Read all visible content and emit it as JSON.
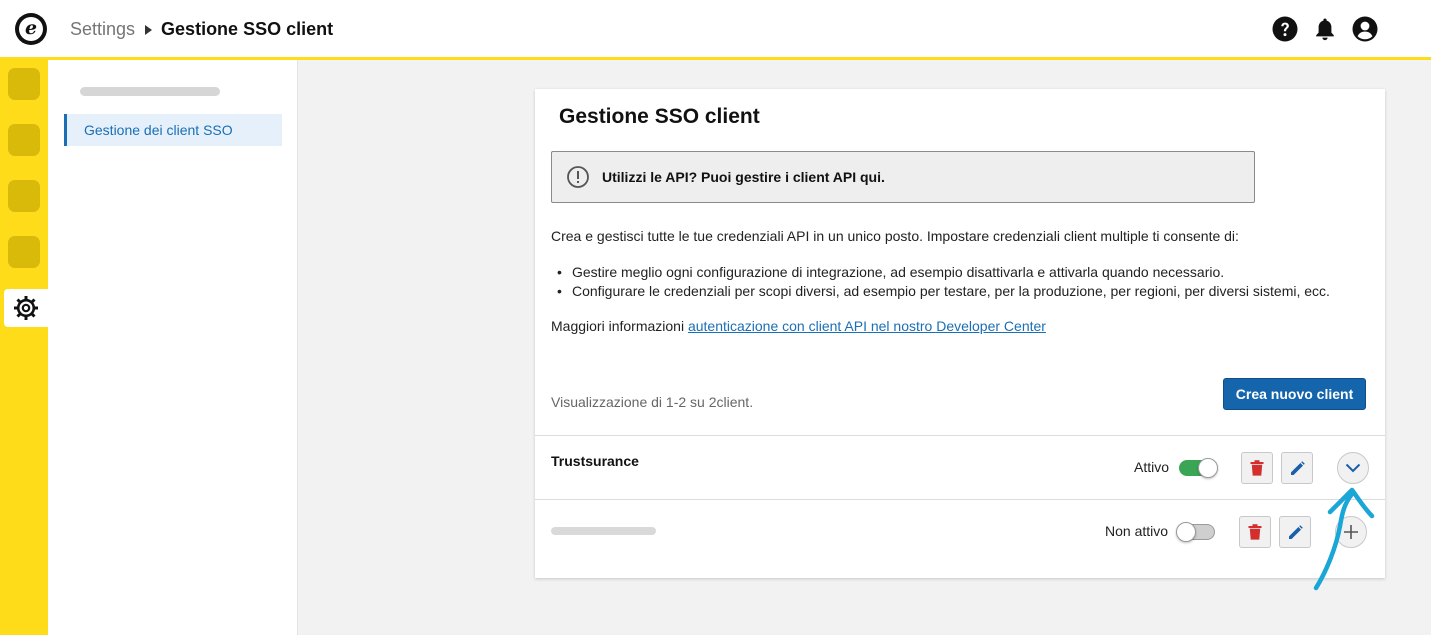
{
  "header": {
    "logo_letter": "e",
    "breadcrumb_root": "Settings",
    "breadcrumb_current": "Gestione SSO client",
    "icons": [
      "help-icon",
      "bell-icon",
      "user-icon"
    ]
  },
  "rail": {
    "active_icon": "gear-icon",
    "accent_color": "#ffdc1a"
  },
  "subnav": {
    "items": [
      {
        "label": "Gestione dei client SSO",
        "active": true
      }
    ]
  },
  "main": {
    "title": "Gestione SSO client",
    "notice": "Utilizzi le API? Puoi gestire i client API qui.",
    "description": "Crea e gestisci tutte le tue credenziali API in un unico posto. Impostare credenziali client multiple ti consente di:",
    "bullets": [
      "Gestire meglio ogni configurazione di integrazione, ad esempio disattivarla e attivarla quando necessario.",
      "Configurare le credenziali per scopi diversi, ad esempio per testare, per la produzione, per regioni, per diversi sistemi, ecc."
    ],
    "more_info_prefix": "Maggiori informazioni ",
    "more_info_link": "autenticazione con client API nel nostro Developer Center",
    "count_text": "Visualizzazione di 1-2 su 2client.",
    "create_button": "Crea nuovo client",
    "clients": [
      {
        "name": "Trustsurance",
        "status": "Attivo",
        "active": true,
        "expand_icon": "chevron-down-icon"
      },
      {
        "name": "",
        "status": "Non attivo",
        "active": false,
        "expand_icon": "plus-icon"
      }
    ]
  },
  "colors": {
    "brand_yellow": "#ffdc1a",
    "primary_blue": "#1565ad",
    "toggle_on": "#3aa655",
    "delete_red": "#d32f2f",
    "annotation": "#1aa6d6"
  }
}
